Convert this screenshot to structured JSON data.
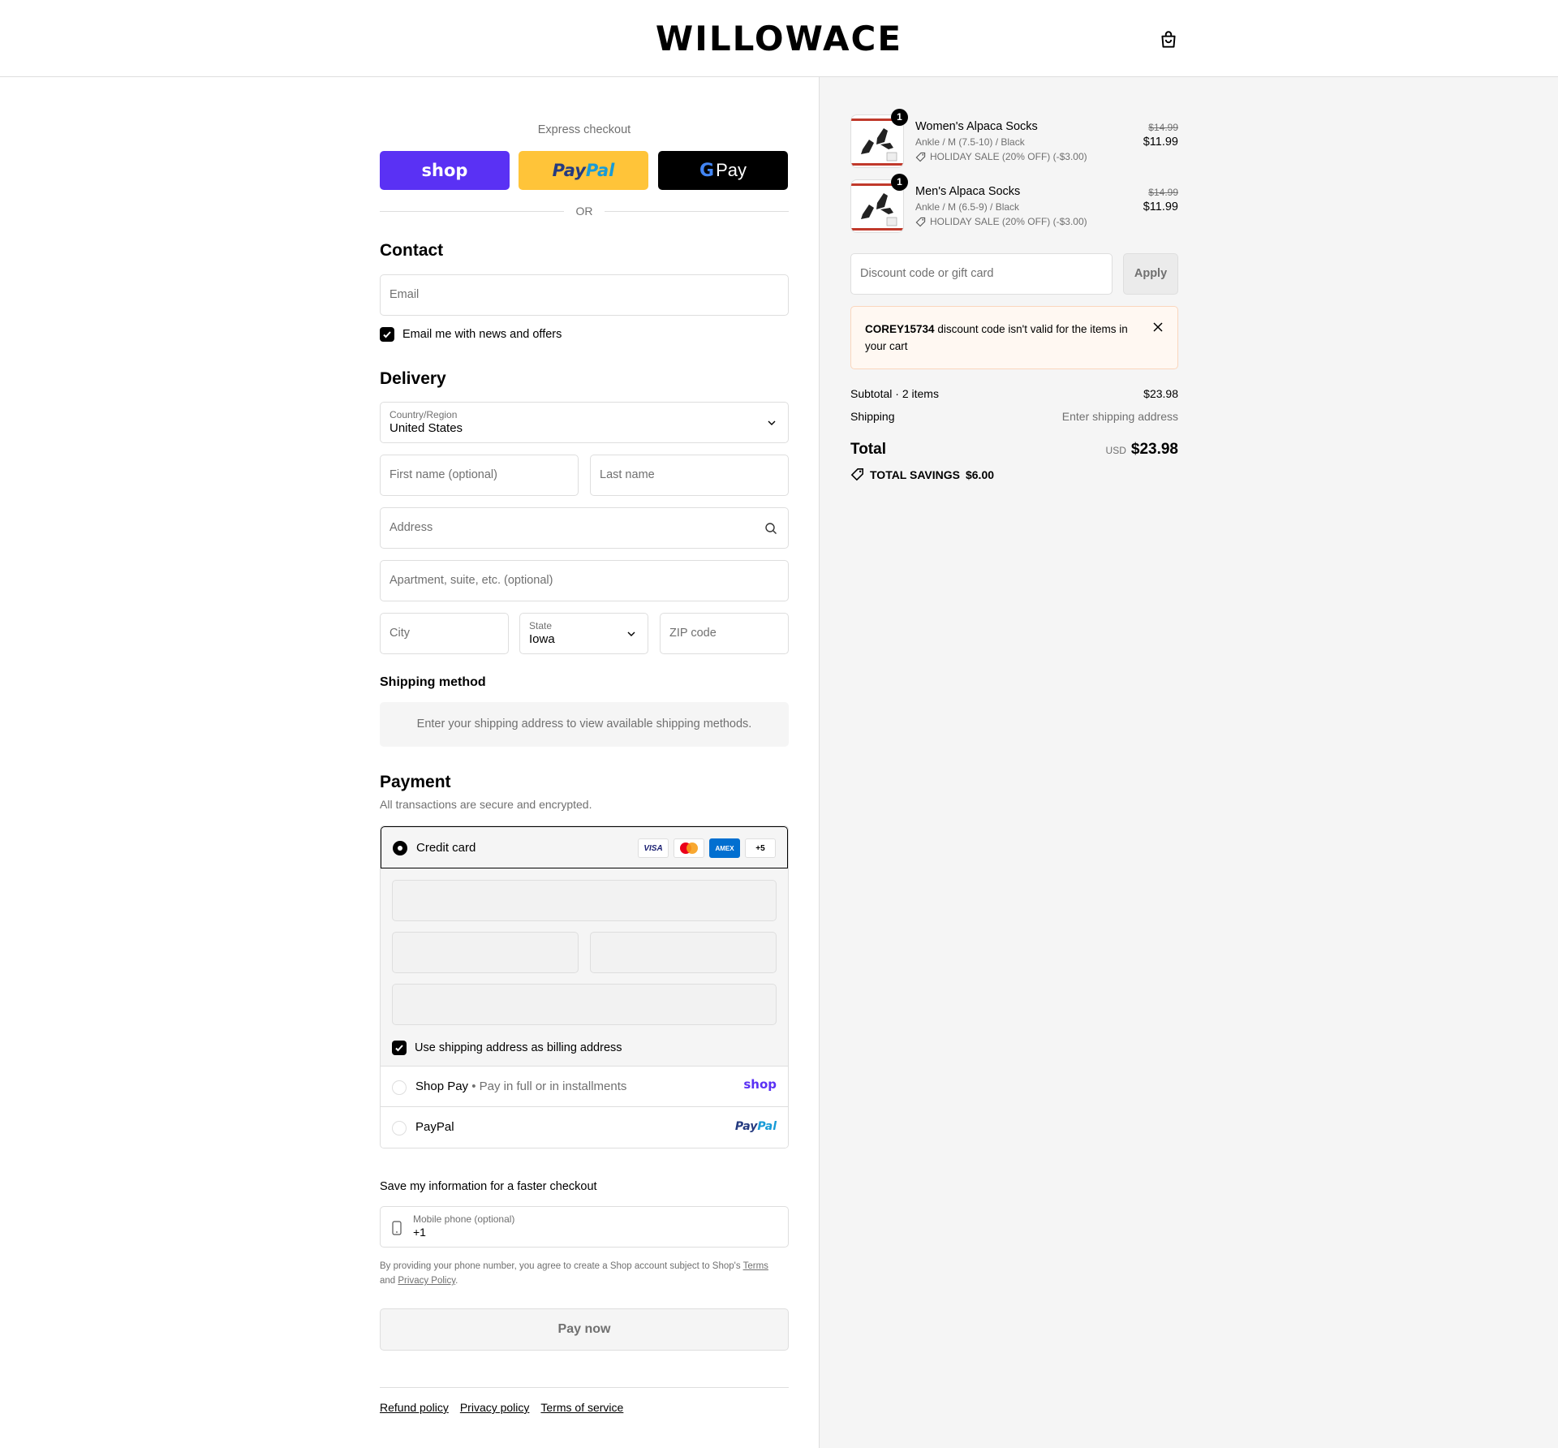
{
  "brand": "WILLOWACE",
  "express": {
    "title": "Express checkout",
    "shop_label": "shop",
    "paypal_part1": "Pay",
    "paypal_part2": "Pal",
    "gpay_label": "Pay",
    "or_label": "OR"
  },
  "contact": {
    "heading": "Contact",
    "email_placeholder": "Email",
    "newsletter_label": "Email me with news and offers"
  },
  "delivery": {
    "heading": "Delivery",
    "country_label": "Country/Region",
    "country_value": "United States",
    "first_name_placeholder": "First name (optional)",
    "last_name_placeholder": "Last name",
    "address_placeholder": "Address",
    "apartment_placeholder": "Apartment, suite, etc. (optional)",
    "city_placeholder": "City",
    "state_label": "State",
    "state_value": "Iowa",
    "zip_placeholder": "ZIP code"
  },
  "shipping_method": {
    "heading": "Shipping method",
    "message": "Enter your shipping address to view available shipping methods."
  },
  "payment": {
    "heading": "Payment",
    "subtitle": "All transactions are secure and encrypted.",
    "credit_card_label": "Credit card",
    "cards": [
      "VISA",
      "AMEX",
      "+5"
    ],
    "billing_label": "Use shipping address as billing address",
    "shop_pay_label": "Shop Pay",
    "shop_pay_sep": " • ",
    "shop_pay_sub": "Pay in full or in installments",
    "shop_logo": "shop",
    "paypal_label": "PayPal"
  },
  "save_info": {
    "heading": "Save my information for a faster checkout",
    "phone_label": "Mobile phone (optional)",
    "phone_value": "+1",
    "terms_prefix": "By providing your phone number, you agree to create a Shop account subject to Shop's ",
    "terms_link": "Terms",
    "terms_and": "and ",
    "privacy_link": "Privacy Policy",
    "terms_end": "."
  },
  "pay_now_label": "Pay now",
  "footer": {
    "refund": "Refund policy",
    "privacy": "Privacy policy",
    "terms": "Terms of service"
  },
  "cart": {
    "items": [
      {
        "name": "Women's Alpaca Socks",
        "variant": "Ankle / M (7.5-10) / Black",
        "discount": "HOLIDAY SALE (20% OFF) (-$3.00)",
        "old_price": "$14.99",
        "price": "$11.99",
        "qty": "1"
      },
      {
        "name": "Men's Alpaca Socks",
        "variant": "Ankle / M (6.5-9) / Black",
        "discount": "HOLIDAY SALE (20% OFF) (-$3.00)",
        "old_price": "$14.99",
        "price": "$11.99",
        "qty": "1"
      }
    ],
    "discount_placeholder": "Discount code or gift card",
    "apply_label": "Apply",
    "error_code": "COREY15734",
    "error_message": " discount code isn't valid for the items in your cart",
    "subtotal_label": "Subtotal · 2 items",
    "subtotal_value": "$23.98",
    "shipping_label": "Shipping",
    "shipping_value": "Enter shipping address",
    "total_label": "Total",
    "currency": "USD",
    "total_value": "$23.98",
    "savings_label": "TOTAL SAVINGS",
    "savings_value": "$6.00"
  },
  "colors": {
    "shop_purple": "#5a31f4",
    "paypal_yellow": "#ffc439",
    "error_bg": "#fff8f2"
  }
}
